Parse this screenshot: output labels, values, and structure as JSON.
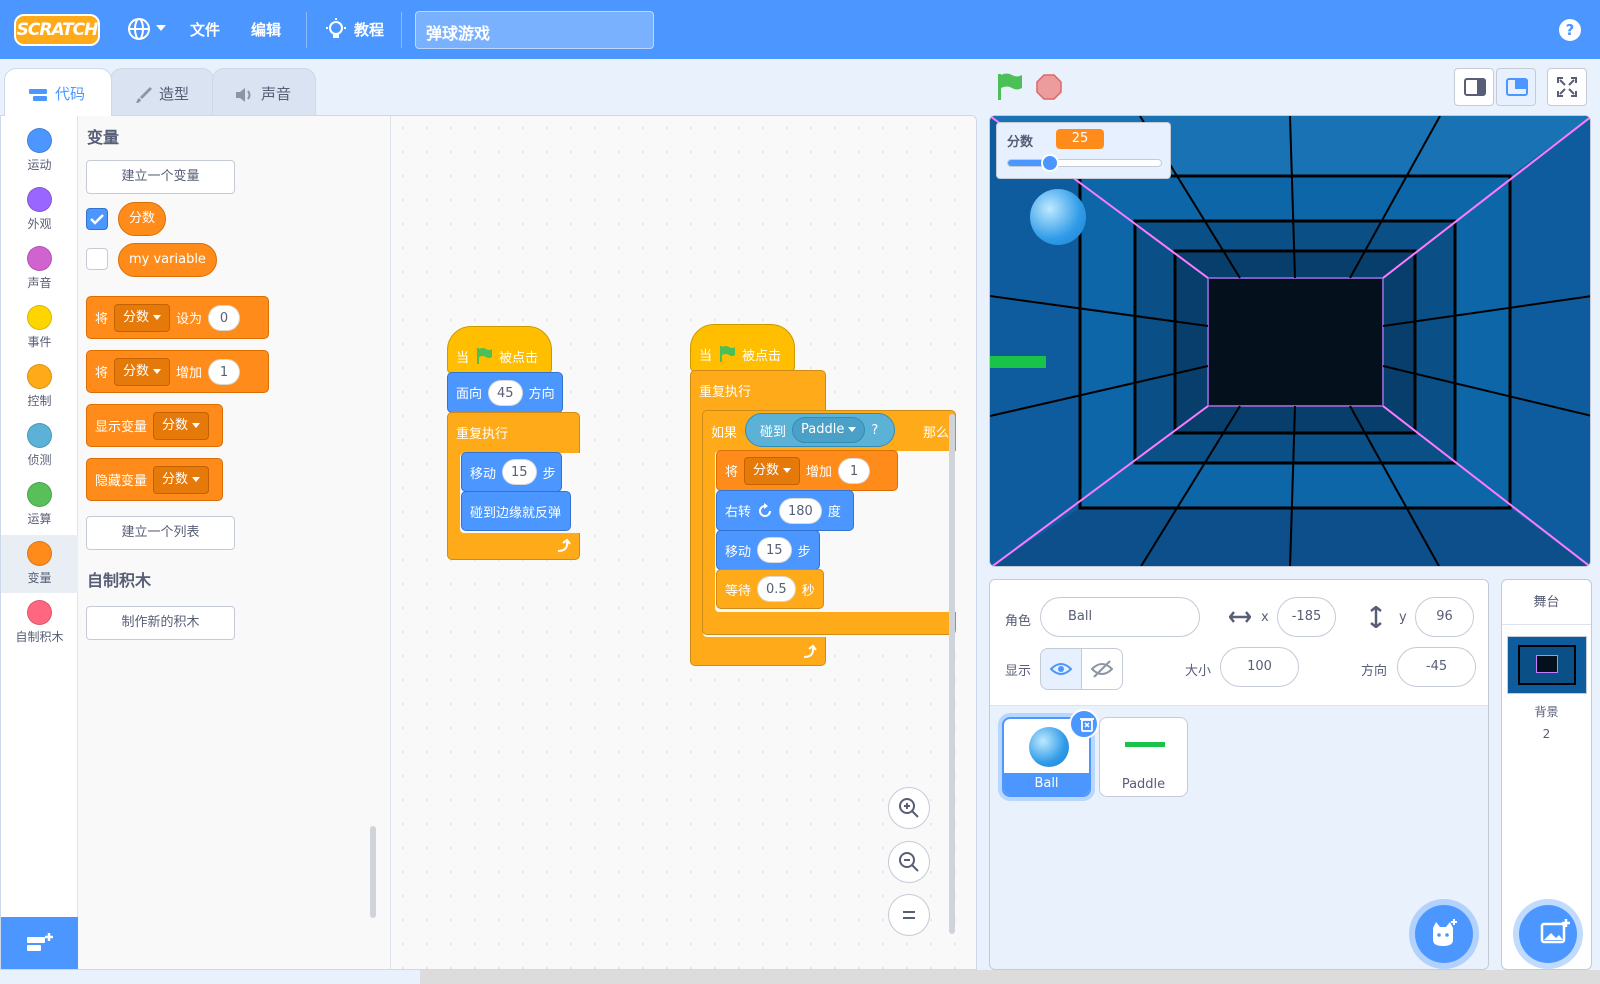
{
  "menubar": {
    "logo": "SCRATCH",
    "file": "文件",
    "edit": "编辑",
    "tutorials": "教程",
    "project_title": "弹球游戏",
    "help": "?"
  },
  "tabs": [
    {
      "label": "代码",
      "active": true
    },
    {
      "label": "造型",
      "active": false
    },
    {
      "label": "声音",
      "active": false
    }
  ],
  "categories": [
    {
      "label": "运动",
      "color": "#4c97ff"
    },
    {
      "label": "外观",
      "color": "#9966ff"
    },
    {
      "label": "声音",
      "color": "#cf63cf"
    },
    {
      "label": "事件",
      "color": "#ffd500"
    },
    {
      "label": "控制",
      "color": "#ffab19"
    },
    {
      "label": "侦测",
      "color": "#5cb1d6"
    },
    {
      "label": "运算",
      "color": "#59c059"
    },
    {
      "label": "变量",
      "color": "#ff8c1a"
    },
    {
      "label": "自制积木",
      "color": "#ff6680"
    }
  ],
  "palette": {
    "heading_variables": "变量",
    "make_variable": "建立一个变量",
    "var_score": "分数",
    "var_my": "my variable",
    "set_label": "将",
    "set_dropdown": "分数",
    "set_to": "设为",
    "set_value": "0",
    "change_label": "将",
    "change_dropdown": "分数",
    "change_by": "增加",
    "change_value": "1",
    "show_var": "显示变量",
    "show_dropdown": "分数",
    "hide_var": "隐藏变量",
    "hide_dropdown": "分数",
    "make_list": "建立一个列表",
    "heading_custom": "自制积木",
    "make_block": "制作新的积木"
  },
  "script1": {
    "when": "当",
    "clicked": "被点击",
    "point": "面向",
    "point_value": "45",
    "direction": "方向",
    "forever": "重复执行",
    "move": "移动",
    "move_value": "15",
    "steps": "步",
    "bounce": "碰到边缘就反弹"
  },
  "script2": {
    "when": "当",
    "clicked": "被点击",
    "forever": "重复执行",
    "if": "如果",
    "touching": "碰到",
    "touching_target": "Paddle",
    "question": "?",
    "then": "那么",
    "change_label": "将",
    "change_dropdown": "分数",
    "change_by": "增加",
    "change_value": "1",
    "turn": "右转",
    "turn_value": "180",
    "degrees": "度",
    "move": "移动",
    "move_value": "15",
    "steps": "步",
    "wait": "等待",
    "wait_value": "0.5",
    "seconds": "秒"
  },
  "stage": {
    "monitor_label": "分数",
    "monitor_value": "25",
    "slider_fraction": 0.27
  },
  "sprite_info": {
    "sprite_label": "角色",
    "sprite_name": "Ball",
    "x_label": "x",
    "x_value": "-185",
    "y_label": "y",
    "y_value": "96",
    "show_label": "显示",
    "size_label": "大小",
    "size_value": "100",
    "direction_label": "方向",
    "direction_value": "-45"
  },
  "sprites": [
    {
      "name": "Ball",
      "selected": true
    },
    {
      "name": "Paddle",
      "selected": false
    }
  ],
  "stage_pane": {
    "title": "舞台",
    "backdrops_label": "背景",
    "backdrops_count": "2"
  },
  "colors": {
    "accent": "#4c97ff",
    "variables": "#ff8c1a",
    "control": "#ffab19",
    "motion": "#4c97ff",
    "events": "#ffbf00",
    "sensing": "#5cb1d6"
  }
}
